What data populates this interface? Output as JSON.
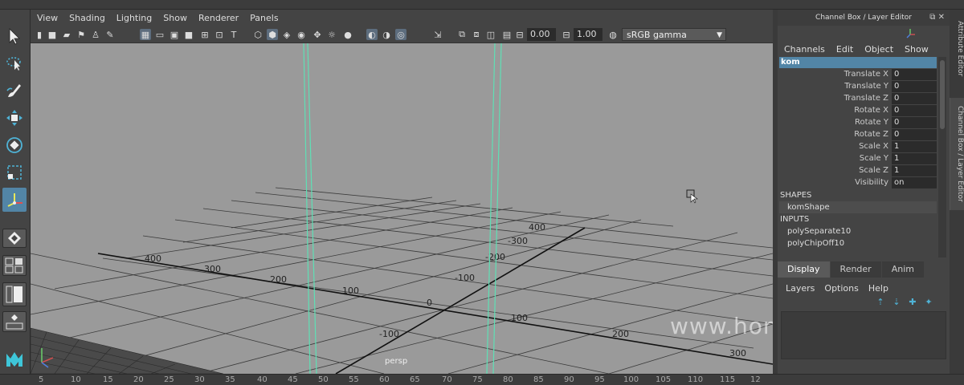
{
  "viewport": {
    "menus": [
      "View",
      "Shading",
      "Lighting",
      "Show",
      "Renderer",
      "Panels"
    ],
    "toolbar": {
      "exposure_value": "0.00",
      "gamma_value": "1.00",
      "color_space": "sRGB gamma"
    },
    "camera_name": "persp",
    "grid_labels": [
      "400",
      "300",
      "200",
      "100",
      "0",
      "100",
      "200",
      "300",
      "400",
      "-300",
      "-200",
      "-100",
      "-100",
      "-200",
      "-300"
    ],
    "watermark": "www.honaramiz.com"
  },
  "channel_box": {
    "title": "Channel Box / Layer Editor",
    "menus": [
      "Channels",
      "Edit",
      "Object",
      "Show"
    ],
    "object_name": "kom",
    "attributes": [
      {
        "name": "Translate X",
        "value": "0"
      },
      {
        "name": "Translate Y",
        "value": "0"
      },
      {
        "name": "Translate Z",
        "value": "0"
      },
      {
        "name": "Rotate X",
        "value": "0"
      },
      {
        "name": "Rotate Y",
        "value": "0"
      },
      {
        "name": "Rotate Z",
        "value": "0"
      },
      {
        "name": "Scale X",
        "value": "1"
      },
      {
        "name": "Scale Y",
        "value": "1"
      },
      {
        "name": "Scale Z",
        "value": "1"
      },
      {
        "name": "Visibility",
        "value": "on"
      }
    ],
    "shapes_header": "SHAPES",
    "shape_item": "komShape",
    "inputs_header": "INPUTS",
    "inputs": [
      "polySeparate10",
      "polyChipOff10"
    ]
  },
  "layer_editor": {
    "tabs": [
      "Display",
      "Render",
      "Anim"
    ],
    "menus": [
      "Layers",
      "Options",
      "Help"
    ]
  },
  "side_tabs": [
    "Attribute Editor",
    "Channel Box / Layer Editor"
  ],
  "timeline": {
    "ticks": [
      "5",
      "10",
      "15",
      "20",
      "25",
      "30",
      "35",
      "40",
      "45",
      "50",
      "55",
      "60",
      "65",
      "70",
      "75",
      "80",
      "85",
      "90",
      "95",
      "100",
      "105",
      "110",
      "115",
      "12"
    ]
  },
  "colors": {
    "accent": "#5285a6",
    "viewport_bg": "#9a9a9a",
    "curve_color": "#5fe0b5",
    "panel_bg": "#444444"
  }
}
